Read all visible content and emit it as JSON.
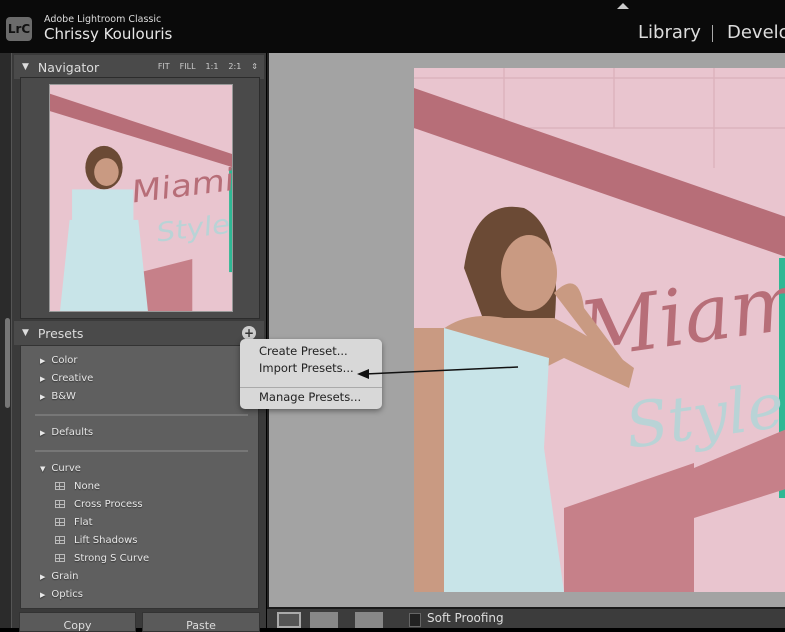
{
  "app": {
    "logo": "LrC",
    "name": "Adobe Lightroom Classic",
    "user": "Chrissy Koulouris"
  },
  "modules": [
    "Library",
    "Develo"
  ],
  "navigator": {
    "title": "Navigator",
    "zoom_options": [
      "FIT",
      "FILL",
      "1:1",
      "2:1"
    ]
  },
  "presets": {
    "title": "Presets",
    "groups_top": [
      "Color",
      "Creative",
      "B&W"
    ],
    "defaults": "Defaults",
    "curve": {
      "label": "Curve",
      "items": [
        "None",
        "Cross Process",
        "Flat",
        "Lift Shadows",
        "Strong S Curve"
      ]
    },
    "groups_bottom": [
      "Grain",
      "Optics"
    ]
  },
  "menu": {
    "items": [
      "Create Preset...",
      "Import Presets...",
      "Manage Presets..."
    ]
  },
  "buttons": {
    "copy": "Copy",
    "paste": "Paste"
  },
  "toolbar": {
    "soft_proofing": "Soft Proofing"
  },
  "photo": {
    "mural_text": [
      "Miami",
      "Style"
    ]
  },
  "colors": {
    "wall": "#e9c5cf",
    "stripe": "#b76e78",
    "dress": "#c8e4e8",
    "window": "#2fb894"
  }
}
